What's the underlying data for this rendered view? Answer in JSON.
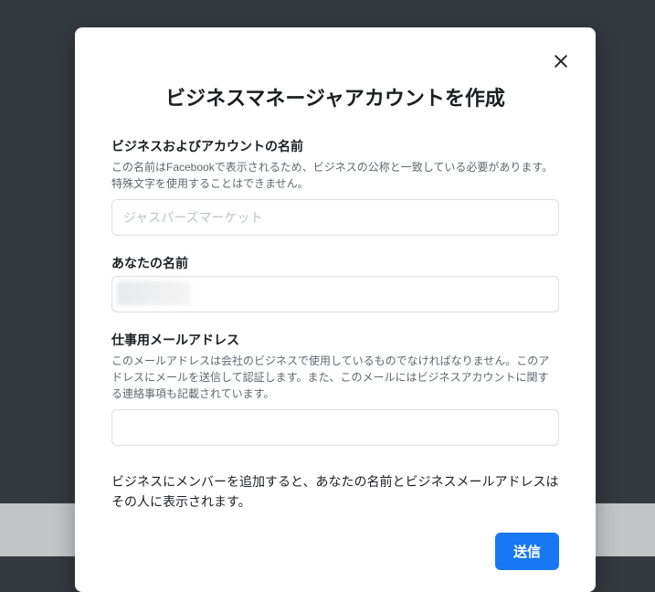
{
  "modal": {
    "title": "ビジネスマネージャアカウントを作成",
    "business_name": {
      "label": "ビジネスおよびアカウントの名前",
      "desc": "この名前はFacebookで表示されるため、ビジネスの公称と一致している必要があります。特殊文字を使用することはできません。",
      "placeholder": "ジャスパーズマーケット"
    },
    "your_name": {
      "label": "あなたの名前"
    },
    "work_email": {
      "label": "仕事用メールアドレス",
      "desc": "このメールアドレスは会社のビジネスで使用しているものでなければなりません。このアドレスにメールを送信して認証します。また、このメールにはビジネスアカウントに関する連絡事項も記載されています。"
    },
    "disclosure": "ビジネスにメンバーを追加すると、あなたの名前とビジネスメールアドレスはその人に表示されます。",
    "submit_label": "送信"
  }
}
